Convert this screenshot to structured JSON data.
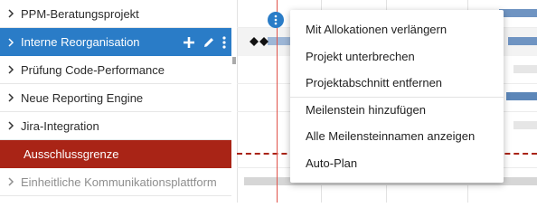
{
  "sidebar": {
    "items": [
      {
        "label": "PPM-Beratungsprojekt"
      },
      {
        "label": "Interne Reorganisation"
      },
      {
        "label": "Prüfung Code-Performance"
      },
      {
        "label": "Neue Reporting Engine"
      },
      {
        "label": "Jira-Integration"
      },
      {
        "label": "Ausschlussgrenze"
      },
      {
        "label": "Einheitliche Kommunikationsplattform"
      }
    ]
  },
  "context_menu": {
    "items": [
      {
        "label": "Mit Allokationen verlängern"
      },
      {
        "label": "Projekt unterbrechen"
      },
      {
        "label": "Projektabschnitt entfernen"
      },
      {
        "label": "Meilenstein hinzufügen"
      },
      {
        "label": "Alle Meilensteinnamen anzeigen"
      },
      {
        "label": "Auto-Plan"
      }
    ]
  },
  "icons": {
    "chevron": "chevron-right-icon",
    "add": "plus-icon",
    "edit": "pencil-icon",
    "more": "vertical-dots-icon",
    "milestone": "diamond-icon"
  },
  "colors": {
    "accent": "#2a7cc7",
    "threshold": "#a92416",
    "bar_blue": "#5c86b8",
    "bar_grey": "#d6d6d6"
  }
}
